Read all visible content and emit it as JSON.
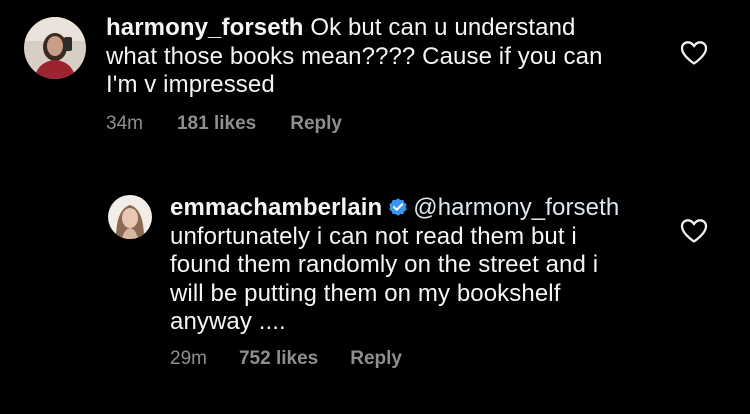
{
  "comments": [
    {
      "username": "harmony_forseth",
      "text": "Ok but can u understand what those books mean???? Cause if you can I'm v impressed",
      "line1": "Ok but can u understand",
      "line2": "what those books mean???? Cause if you can",
      "line3": "I'm v impressed",
      "time": "34m",
      "likes": "181 likes",
      "reply_label": "Reply",
      "verified": false
    },
    {
      "username": "emmachamberlain",
      "mention": "@harmony_forseth",
      "line1": "unfortunately i can not read them but i",
      "line2": "found them randomly on the street and i",
      "line3": "will be putting them on my bookshelf",
      "line4": "anyway ....",
      "time": "29m",
      "likes": "752 likes",
      "reply_label": "Reply",
      "verified": true
    }
  ],
  "colors": {
    "background": "#000000",
    "text": "#f5f5f5",
    "meta": "#8e8e8e",
    "verified_blue": "#3897f0"
  },
  "icons": {
    "like": "heart-outline-icon",
    "verified": "verified-badge-icon"
  }
}
